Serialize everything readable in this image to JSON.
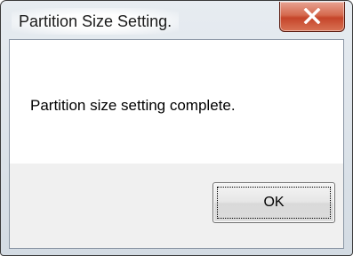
{
  "window": {
    "title": "Partition Size Setting."
  },
  "dialog": {
    "message": "Partition size setting complete.",
    "ok_label": "OK"
  },
  "icons": {
    "close": "close-icon"
  },
  "colors": {
    "close_button": "#c5452a",
    "footer_background": "#f0f0f0",
    "frame": "#d3dbe3"
  }
}
